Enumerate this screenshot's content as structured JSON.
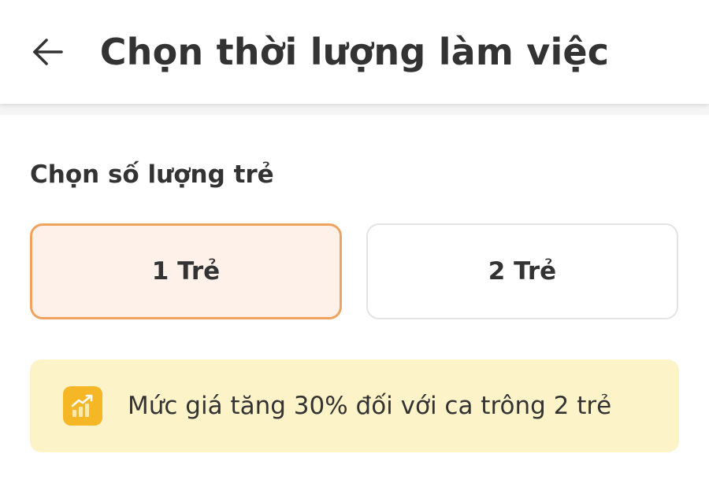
{
  "header": {
    "back_icon": "arrow-left-icon",
    "title": "Chọn thời lượng làm việc"
  },
  "children_section": {
    "label": "Chọn số lượng trẻ",
    "options": [
      {
        "label": "1 Trẻ",
        "selected": true
      },
      {
        "label": "2 Trẻ",
        "selected": false
      }
    ]
  },
  "notice": {
    "icon": "trending-up-icon",
    "text": "Mức giá tăng 30% đối với ca trông 2 trẻ"
  },
  "colors": {
    "selected_border": "#f0a35e",
    "selected_background": "#fef1ea",
    "notice_background": "#fdf3c9",
    "notice_icon_background": "#f6b727"
  }
}
